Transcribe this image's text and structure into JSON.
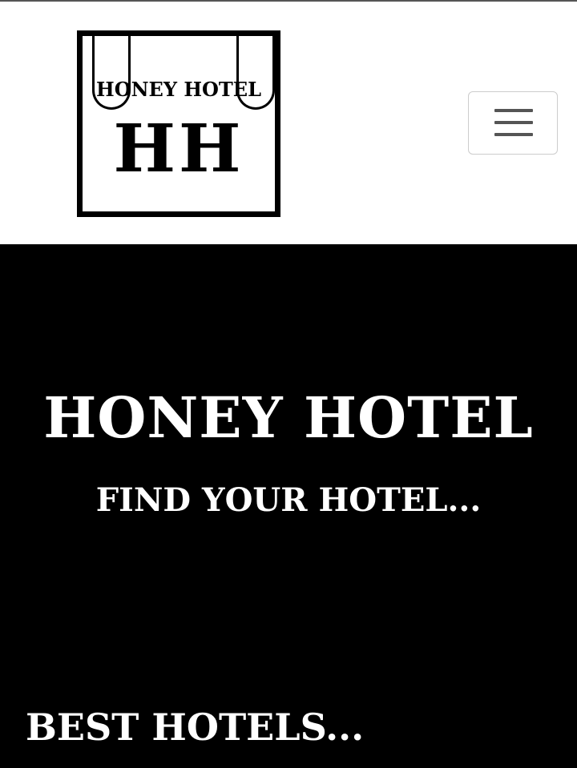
{
  "brand": {
    "logo_name": "HONEY HOTEL",
    "logo_mark": "HH"
  },
  "nav": {
    "toggle_icon": "hamburger-menu-icon"
  },
  "hero": {
    "title": "HONEY HOTEL",
    "subtitle": "FIND YOUR HOTEL..."
  },
  "sections": {
    "best_hotels_heading": "BEST HOTELS..."
  },
  "colors": {
    "header_bg": "#ffffff",
    "hero_bg": "#000000",
    "text_light": "#ffffff",
    "text_dark": "#000000",
    "toggle_bar": "#555555"
  }
}
